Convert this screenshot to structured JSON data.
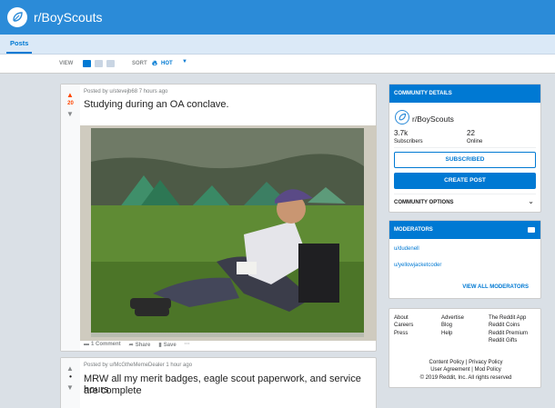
{
  "banner": {
    "title": "r/BoyScouts"
  },
  "tabs": [
    {
      "label": "Posts"
    }
  ],
  "toolbar": {
    "view_label": "VIEW",
    "sort_label": "SORT",
    "sort_value": "HOT"
  },
  "posts": [
    {
      "meta": "Posted by u/stevejb68 7 hours ago",
      "score": "20",
      "title": "Studying during an OA conclave.",
      "actions": {
        "comments": "1 Comment",
        "share": "Share",
        "save": "Save",
        "more": "···"
      }
    },
    {
      "meta": "Posted by u/McGtheMemeDealer 1 hour ago",
      "score": "•",
      "title_line1": "MRW all my merit badges, eagle scout paperwork, and service hours",
      "title_line2": "are complete"
    }
  ],
  "community": {
    "header": "COMMUNITY DETAILS",
    "name": "r/BoyScouts",
    "subscribers": "3.7k",
    "subscribers_label": "Subscribers",
    "online": "22",
    "online_label": "Online",
    "subscribed_button": "SUBSCRIBED",
    "create_button": "CREATE POST",
    "options_label": "COMMUNITY OPTIONS"
  },
  "moderators": {
    "header": "MODERATORS",
    "list": [
      "u/dudenell",
      "u/yellowjacketcoder"
    ],
    "view_all": "VIEW ALL MODERATORS"
  },
  "footer": {
    "col1": [
      "About",
      "Careers",
      "Press"
    ],
    "col2": [
      "Advertise",
      "Blog",
      "Help"
    ],
    "col3": [
      "The Reddit App",
      "Reddit Coins",
      "Reddit Premium",
      "Reddit Gifts"
    ],
    "line1": "Content Policy | Privacy Policy",
    "line2": "User Agreement | Mod Policy",
    "line3": "© 2019 Reddit, Inc. All rights reserved"
  }
}
